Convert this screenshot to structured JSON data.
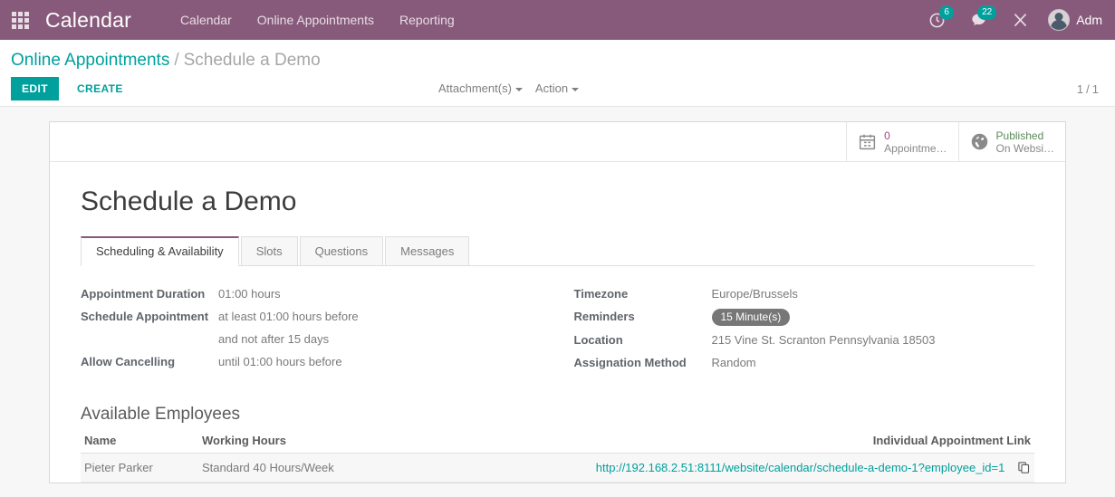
{
  "navbar": {
    "apps_icon": "apps-grid-icon",
    "brand": "Calendar",
    "menus": [
      {
        "label": "Calendar"
      },
      {
        "label": "Online Appointments"
      },
      {
        "label": "Reporting"
      }
    ],
    "systray": {
      "activity_icon": "clock-icon",
      "activity_count": "6",
      "messages_icon": "speech-bubble-icon",
      "messages_count": "22",
      "debug_icon": "tools-icon",
      "avatar_icon": "user-avatar",
      "user_name": "Adm"
    }
  },
  "control_panel": {
    "breadcrumb": {
      "parent": "Online Appointments",
      "separator": "/",
      "current": "Schedule a Demo"
    },
    "edit_label": "EDIT",
    "create_label": "CREATE",
    "attachments_label": "Attachment(s)",
    "action_label": "Action",
    "pager": {
      "current": "1",
      "separator": "/",
      "total": "1"
    }
  },
  "stat_buttons": [
    {
      "icon": "calendar-icon",
      "value": "0",
      "label": "Appointme…",
      "color": "#a24689"
    },
    {
      "icon": "globe-icon",
      "value": "Published",
      "label": "On Websi…",
      "color": "#5a8a5a"
    }
  ],
  "form": {
    "title": "Schedule a Demo",
    "tabs": [
      {
        "label": "Scheduling & Availability",
        "active": true
      },
      {
        "label": "Slots",
        "active": false
      },
      {
        "label": "Questions",
        "active": false
      },
      {
        "label": "Messages",
        "active": false
      }
    ],
    "left_fields": [
      {
        "label": "Appointment Duration",
        "value": "01:00 hours"
      },
      {
        "label": "Schedule Appointment",
        "value": "at least 01:00 hours before"
      },
      {
        "label": "",
        "value": "and not after 15 days"
      },
      {
        "label": "Allow Cancelling",
        "value": "until 01:00 hours before"
      }
    ],
    "right_fields": [
      {
        "label": "Timezone",
        "value": "Europe/Brussels",
        "type": "text"
      },
      {
        "label": "Reminders",
        "value": "15 Minute(s)",
        "type": "badge"
      },
      {
        "label": "Location",
        "value": "215 Vine St. Scranton Pennsylvania 18503",
        "type": "text"
      },
      {
        "label": "Assignation Method",
        "value": "Random",
        "type": "text"
      }
    ],
    "employees": {
      "section_title": "Available Employees",
      "columns": [
        "Name",
        "Working Hours",
        "Individual Appointment Link"
      ],
      "rows": [
        {
          "name": "Pieter Parker",
          "working_hours": "Standard 40 Hours/Week",
          "link": "http://192.168.2.51:8111/website/calendar/schedule-a-demo-1?employee_id=1",
          "copy_icon": "copy-icon"
        }
      ]
    }
  },
  "colors": {
    "brand_purple": "#875a7b",
    "accent_teal": "#00a09d",
    "badge_gray": "#777777",
    "page_bg": "#f7f7f7"
  }
}
